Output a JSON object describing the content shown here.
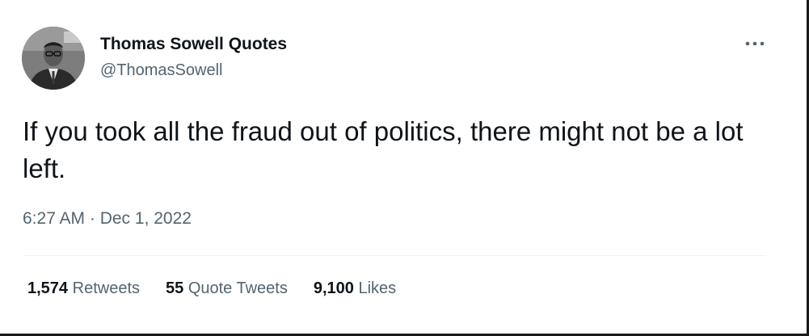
{
  "tweet": {
    "display_name": "Thomas Sowell Quotes",
    "handle": "@ThomasSowell",
    "text": "If you took all the fraud out of politics, there might not be a lot left.",
    "timestamp": "6:27 AM · Dec 1, 2022",
    "avatar_icon": "avatar-portrait-icon",
    "more_icon": "more-options-icon"
  },
  "stats": {
    "retweets_count": "1,574",
    "retweets_label": "Retweets",
    "quote_tweets_count": "55",
    "quote_tweets_label": "Quote Tweets",
    "likes_count": "9,100",
    "likes_label": "Likes"
  },
  "colors": {
    "text_primary": "#0f1419",
    "text_secondary": "#536471",
    "divider": "#eff3f4",
    "background": "#ffffff"
  }
}
